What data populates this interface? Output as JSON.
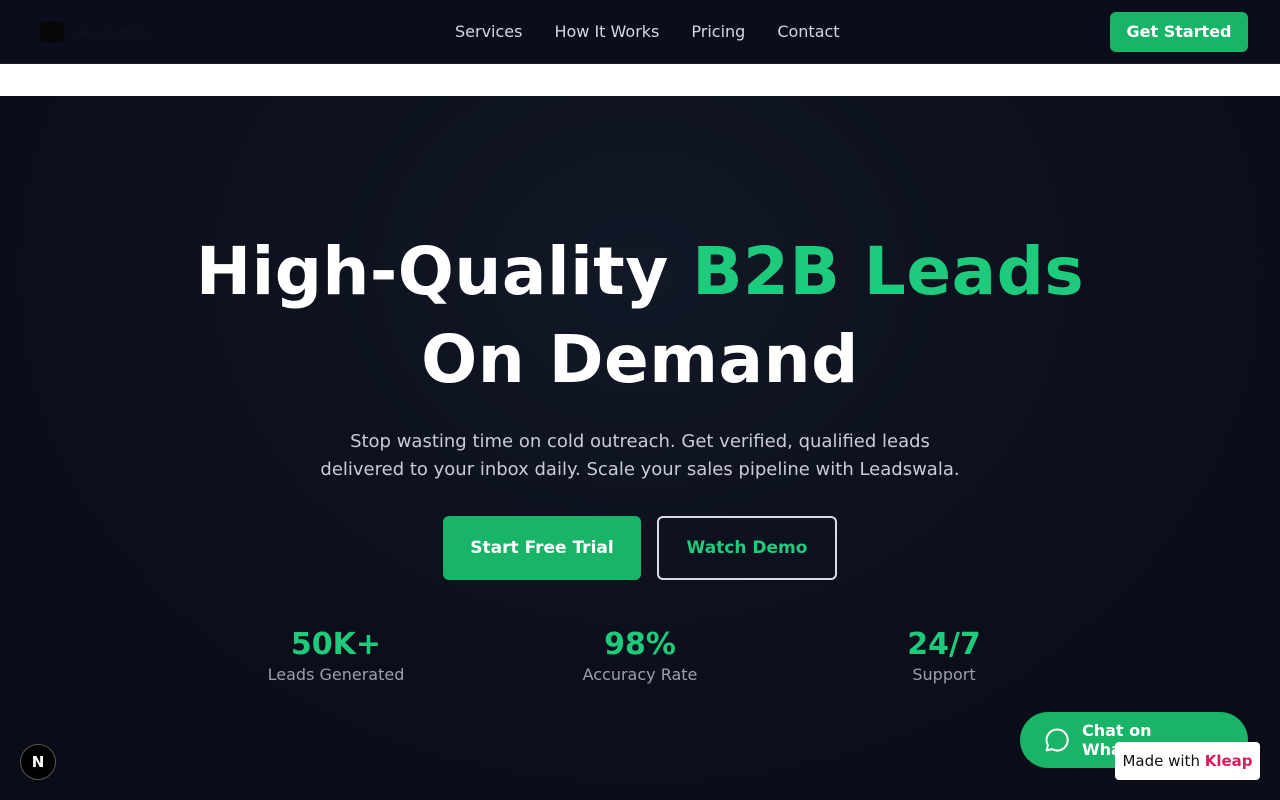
{
  "header": {
    "logo_text": "Leadswala",
    "nav": [
      "Services",
      "How It Works",
      "Pricing",
      "Contact"
    ],
    "cta_label": "Get Started"
  },
  "hero": {
    "title_part1": "High-Quality ",
    "title_accent": "B2B Leads",
    "title_line2": "On Demand",
    "subtitle_line1": "Stop wasting time on cold outreach. Get verified, qualified leads",
    "subtitle_line2": "delivered to your inbox daily. Scale your sales pipeline with Leadswala.",
    "primary_button": "Start Free Trial",
    "secondary_button": "Watch Demo",
    "stats": [
      {
        "value": "50K+",
        "label": "Leads Generated"
      },
      {
        "value": "98%",
        "label": "Accuracy Rate"
      },
      {
        "value": "24/7",
        "label": "Support"
      }
    ]
  },
  "floating": {
    "badge_letter": "N",
    "whatsapp_label": "Chat on WhatsApp",
    "made_with_prefix": "Made with ",
    "made_with_brand": "Kleap"
  },
  "colors": {
    "accent": "#1ecb7c",
    "button_green": "#18b468",
    "nav_bg": "#0a0d1c",
    "hero_bg": "#0c0f1b"
  },
  "icons": {
    "whatsapp": "chat-bubble-icon"
  }
}
